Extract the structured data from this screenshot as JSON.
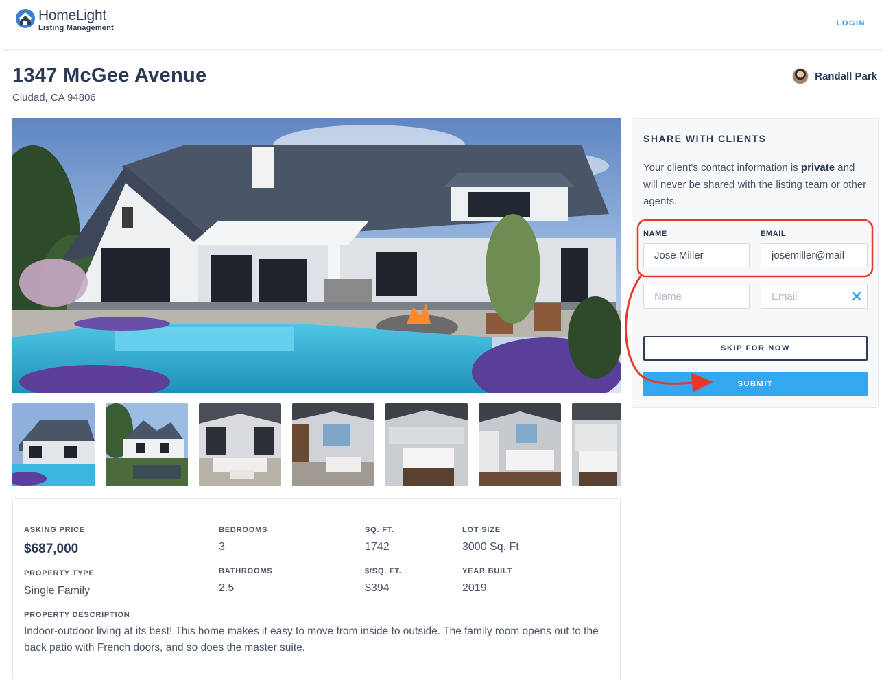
{
  "header": {
    "brand_name": "HomeLight",
    "brand_sub": "Listing Management",
    "login_label": "LOGIN"
  },
  "listing": {
    "title": "1347 McGee Avenue",
    "address": "Ciudad, CA 94806",
    "agent_name": "Randall Park"
  },
  "thumbnails": [
    {
      "scene": "exterior-rear"
    },
    {
      "scene": "exterior-front"
    },
    {
      "scene": "living-room"
    },
    {
      "scene": "living-room-2"
    },
    {
      "scene": "kitchen"
    },
    {
      "scene": "kitchen-2"
    },
    {
      "scene": "kitchen-3"
    }
  ],
  "details": {
    "asking_price_label": "ASKING PRICE",
    "asking_price": "$687,000",
    "bedrooms_label": "BEDROOMS",
    "bedrooms": "3",
    "sqft_label": "SQ. FT.",
    "sqft": "1742",
    "lot_size_label": "LOT SIZE",
    "lot_size": "3000 Sq. Ft",
    "property_type_label": "PROPERTY TYPE",
    "property_type": "Single Family",
    "bathrooms_label": "BATHROOMS",
    "bathrooms": "2.5",
    "price_per_sqft_label": "$/SQ. FT.",
    "price_per_sqft": "$394",
    "year_built_label": "YEAR BUILT",
    "year_built": "2019",
    "description_label": "PROPERTY DESCRIPTION",
    "description": "Indoor-outdoor living at its best! This home makes it easy to move from inside to outside. The family room opens out to the back patio with French doors, and so does the master suite."
  },
  "share": {
    "title": "SHARE WITH CLIENTS",
    "text_before": "Your client's contact information is ",
    "text_bold": "private",
    "text_after": " and will never be shared with the listing team or other agents.",
    "name_label": "NAME",
    "email_label": "EMAIL",
    "name_value": "Jose Miller",
    "email_value": "josemiller@mail",
    "name_placeholder": "Name",
    "email_placeholder": "Email",
    "clear_symbol": "✕",
    "skip_label": "SKIP FOR NOW",
    "submit_label": "SUBMIT"
  },
  "colors": {
    "accent": "#34a7f1",
    "annotation": "#e8372b",
    "navy": "#2a3a55"
  }
}
